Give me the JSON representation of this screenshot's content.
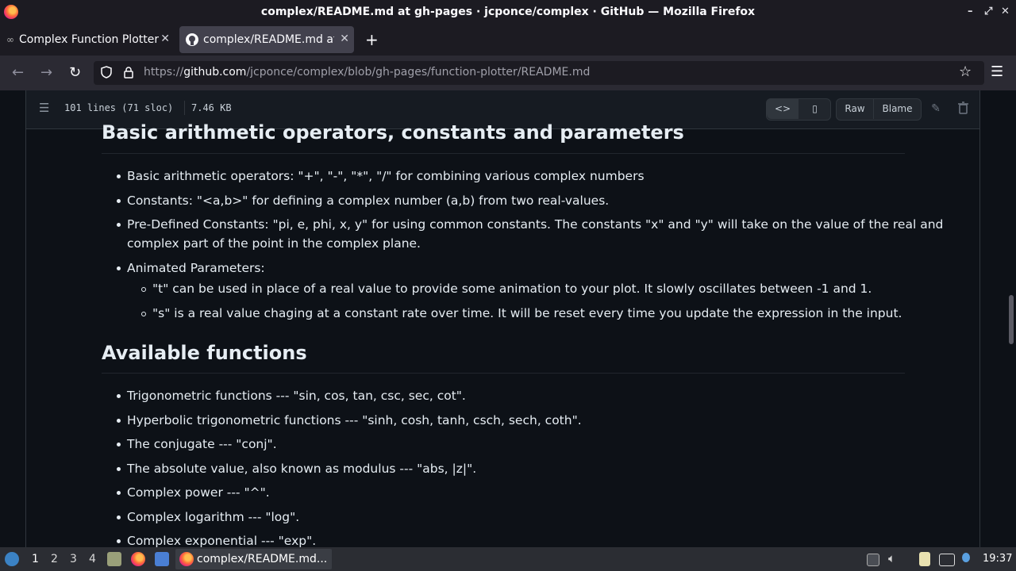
{
  "window": {
    "title": "complex/README.md at gh-pages · jcponce/complex · GitHub — Mozilla Firefox",
    "controls": [
      "–",
      "⤢",
      "✕"
    ]
  },
  "tabs": [
    {
      "label": "Complex Function Plotter",
      "active": false
    },
    {
      "label": "complex/README.md at gh-pages",
      "active": true
    }
  ],
  "newtab_label": "+",
  "nav": {
    "url_prefix": "https://",
    "url_host": "github.com",
    "url_path": "/jcponce/complex/blob/gh-pages/function-plotter/README.md"
  },
  "file_header": {
    "lines": "101 lines (71 sloc)",
    "size": "7.46 KB",
    "raw_label": "Raw",
    "blame_label": "Blame"
  },
  "readme": {
    "section1": {
      "heading": "Basic arithmetic operators, constants and parameters",
      "items": [
        "Basic arithmetic operators: \"+\", \"-\", \"*\", \"/\" for combining various complex numbers",
        "Constants: \"<a,b>\" for defining a complex number (a,b) from two real-values.",
        "Pre-Defined Constants: \"pi, e, phi, x, y\" for using common constants. The constants \"x\" and \"y\" will take on the value of the real and",
        "complex part of the point in the complex plane.",
        "Animated Parameters:"
      ],
      "subitems": [
        "\"t\" can be used in place of a real value to provide some animation to your plot. It slowly oscillates between -1 and 1.",
        "\"s\" is a real value chaging at a constant rate over time. It will be reset every time you update the expression in the input."
      ]
    },
    "section2": {
      "heading": "Available functions",
      "items": [
        "Trigonometric functions --- \"sin, cos, tan, csc, sec, cot\".",
        "Hyperbolic trigonometric functions --- \"sinh, cosh, tanh, csch, sech, coth\".",
        "The conjugate --- \"conj\".",
        "The absolute value, also known as modulus --- \"abs, |z|\".",
        "Complex power --- \"^\".",
        "Complex logarithm --- \"log\".",
        "Complex exponential --- \"exp\"."
      ]
    }
  },
  "taskbar": {
    "workspaces": [
      "1",
      "2",
      "3",
      "4"
    ],
    "active_app": "complex/README.md...",
    "clock": "19:37"
  }
}
